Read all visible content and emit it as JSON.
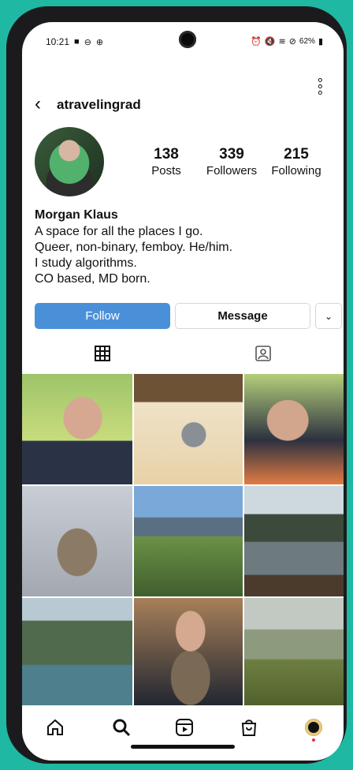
{
  "status_bar": {
    "time": "10:21",
    "battery": "62%"
  },
  "header": {
    "username": "atravelingrad",
    "more_icon": "more-vertical-icon"
  },
  "profile": {
    "stats": [
      {
        "value": "138",
        "label": "Posts"
      },
      {
        "value": "339",
        "label": "Followers"
      },
      {
        "value": "215",
        "label": "Following"
      }
    ],
    "name": "Morgan Klaus",
    "bio_lines": [
      "A space for all the places I go.",
      "Queer, non-binary, femboy. He/him.",
      "I study algorithms.",
      "CO based, MD born."
    ]
  },
  "actions": {
    "follow": "Follow",
    "message": "Message"
  },
  "tabs": [
    "grid-icon",
    "tagged-icon"
  ],
  "grid_items": 9,
  "bottom_nav": [
    "home-icon",
    "search-icon",
    "reels-icon",
    "shop-icon",
    "profile-avatar"
  ],
  "colors": {
    "follow_button": "#4a90d9",
    "background": "#1fb8a3",
    "notification_dot": "#e0333a"
  }
}
